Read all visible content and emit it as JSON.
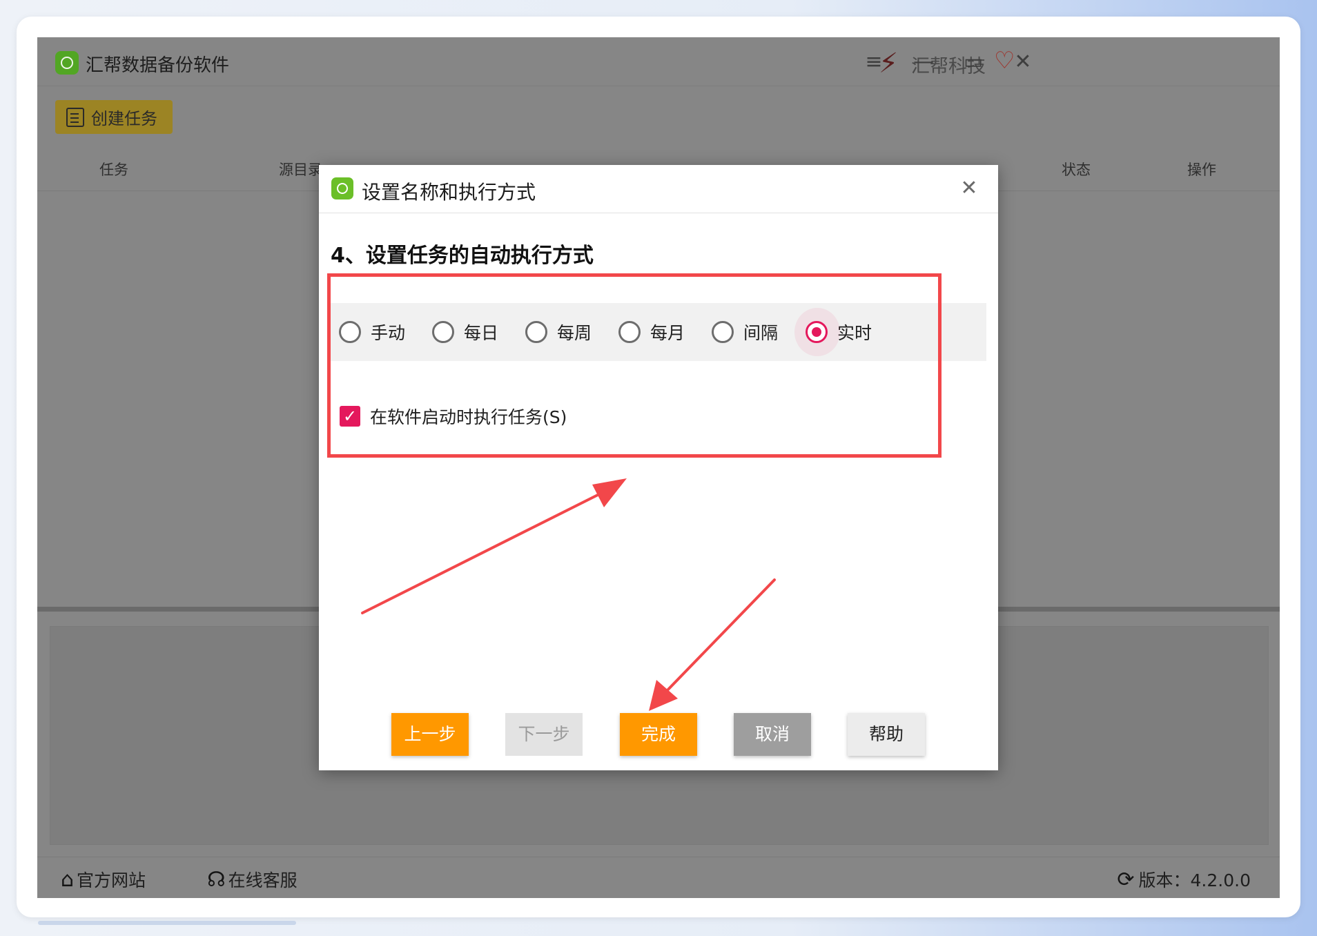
{
  "app": {
    "title": "汇帮数据备份软件",
    "brand_name": "汇帮科技",
    "create_task_label": "创建任务"
  },
  "table": {
    "headers": [
      "任务",
      "源目录",
      "状态",
      "操作"
    ]
  },
  "statusbar": {
    "website_label": "官方网站",
    "support_label": "在线客服",
    "version_label": "版本：4.2.0.0"
  },
  "dialog": {
    "title": "设置名称和执行方式",
    "heading": "4、设置任务的自动执行方式",
    "modes": [
      {
        "label": "手动",
        "selected": false
      },
      {
        "label": "每日",
        "selected": false
      },
      {
        "label": "每周",
        "selected": false
      },
      {
        "label": "每月",
        "selected": false
      },
      {
        "label": "间隔",
        "selected": false
      },
      {
        "label": "实时",
        "selected": true
      }
    ],
    "startup_checkbox": {
      "label": "在软件启动时执行任务(S)",
      "checked": true
    },
    "buttons": {
      "prev": "上一步",
      "next": "下一步",
      "finish": "完成",
      "cancel": "取消",
      "help": "帮助"
    }
  },
  "icons": {
    "app_logo": "app-logo-icon",
    "brand": "brand-logo-icon",
    "heart": "heart-icon",
    "menu": "menu-icon",
    "minimize": "minimize-icon",
    "maximize": "maximize-icon",
    "close": "close-icon",
    "home": "home-icon",
    "headset": "headset-icon",
    "refresh": "refresh-icon"
  },
  "colors": {
    "accent": "#e4185c",
    "primary_button": "#ff9800",
    "annotation": "#f2474a",
    "overlay": "#868686"
  }
}
